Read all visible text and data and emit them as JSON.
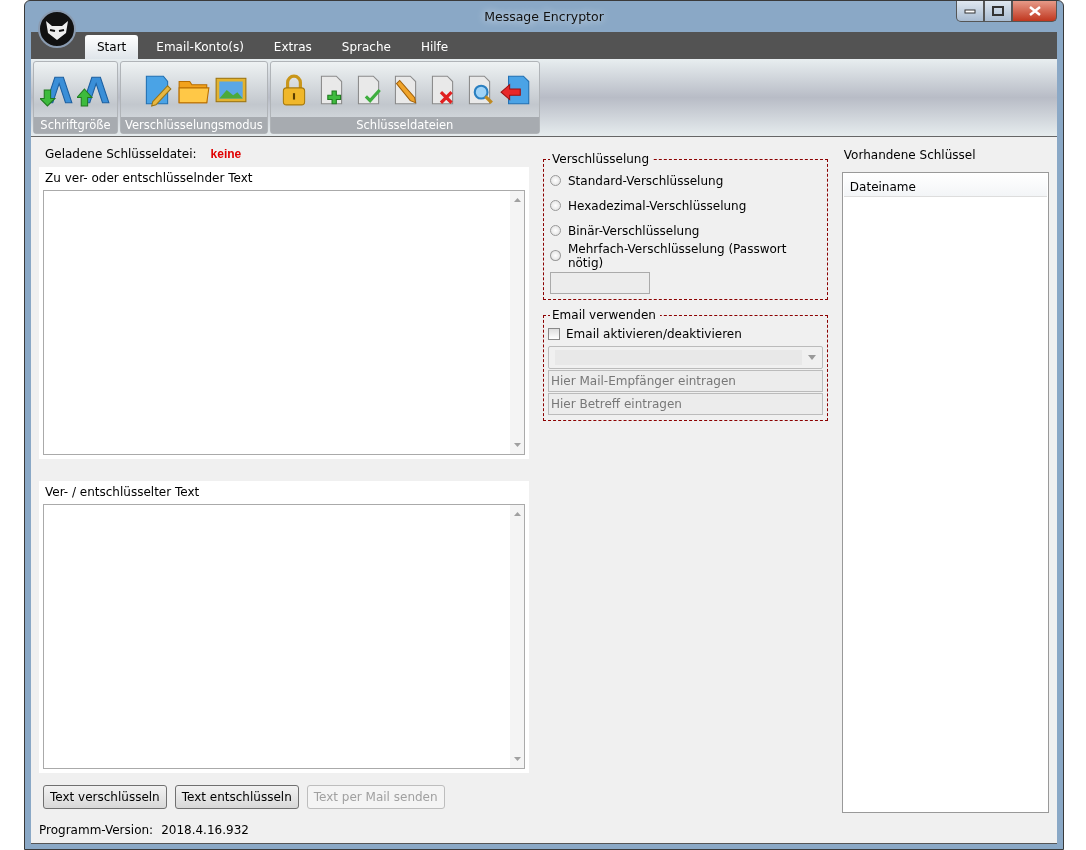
{
  "window": {
    "title": "Message Encryptor"
  },
  "menu_tabs": [
    {
      "label": "Start",
      "selected": true
    },
    {
      "label": "Email-Konto(s)",
      "selected": false
    },
    {
      "label": "Extras",
      "selected": false
    },
    {
      "label": "Sprache",
      "selected": false
    },
    {
      "label": "Hilfe",
      "selected": false
    }
  ],
  "ribbon_groups": [
    {
      "label": "Schriftgröße",
      "buttons": [
        {
          "kind": "font-smaller"
        },
        {
          "kind": "font-larger"
        }
      ]
    },
    {
      "label": "Verschlüsselungsmodus",
      "buttons": [
        {
          "kind": "write"
        },
        {
          "kind": "folder"
        },
        {
          "kind": "image"
        }
      ]
    },
    {
      "label": "Schlüsseldateien",
      "buttons": [
        {
          "kind": "lock"
        },
        {
          "kind": "add"
        },
        {
          "kind": "check"
        },
        {
          "kind": "edit"
        },
        {
          "kind": "delete"
        },
        {
          "kind": "search"
        },
        {
          "kind": "back"
        }
      ]
    }
  ],
  "loaded_key": {
    "label": "Geladene Schlüsseldatei:",
    "value": "keine"
  },
  "input_panel": {
    "label": "Zu ver- oder entschlüsselnder Text"
  },
  "output_panel": {
    "label": "Ver- / entschlüsselter Text"
  },
  "action_buttons": [
    {
      "label": "Text verschlüsseln",
      "disabled": false
    },
    {
      "label": "Text entschlüsseln",
      "disabled": false
    },
    {
      "label": "Text per Mail senden",
      "disabled": true
    }
  ],
  "encryption": {
    "title": "Verschlüsselung",
    "options": [
      {
        "label": "Standard-Verschlüsselung",
        "selected": false
      },
      {
        "label": "Hexadezimal-Verschlüsselung",
        "selected": false
      },
      {
        "label": "Binär-Verschlüsselung",
        "selected": false
      },
      {
        "label": "Mehrfach-Verschlüsselung (Passwort nötig)",
        "selected": false
      }
    ]
  },
  "email": {
    "title": "Email verwenden",
    "checkbox": {
      "label": "Email aktivieren/deaktivieren",
      "checked": false
    },
    "recipient_placeholder": "Hier Mail-Empfänger eintragen",
    "subject_placeholder": "Hier Betreff eintragen"
  },
  "keys": {
    "title": "Vorhandene Schlüssel",
    "columns": [
      "Dateiname"
    ]
  },
  "status_bar": {
    "label": "Programm-Version:",
    "value": "2018.4.16.932"
  }
}
